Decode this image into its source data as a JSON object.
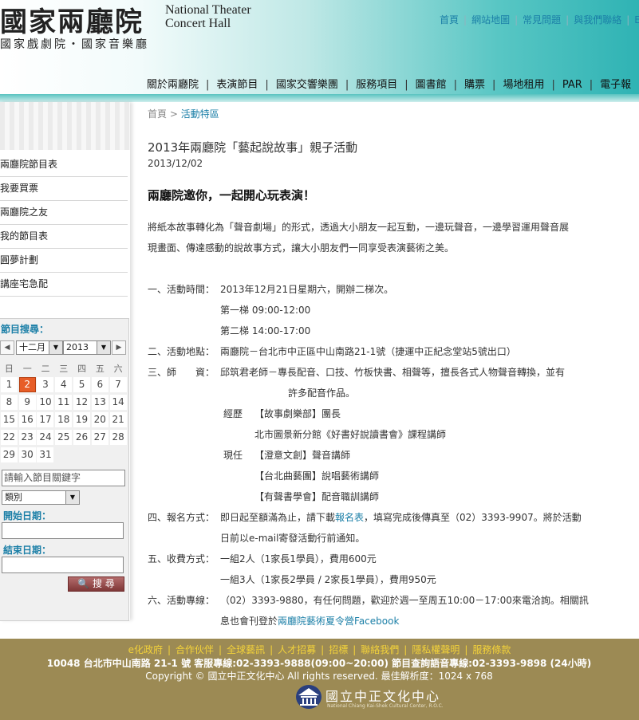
{
  "header": {
    "logo_cn": "國家兩廳院",
    "logo_en_line1": "National Theater",
    "logo_en_line2": "Concert Hall",
    "logo_sub": "國家戲劇院・國家音樂廳",
    "top_links": [
      "首頁",
      "網站地圖",
      "常見問題",
      "與我們聯絡",
      "En"
    ],
    "main_nav": [
      "關於兩廳院",
      "表演節目",
      "國家交響樂團",
      "服務項目",
      "圖書館",
      "購票",
      "場地租用",
      "PAR",
      "電子報"
    ]
  },
  "sidebar": {
    "items": [
      "兩廳院節目表",
      "我要買票",
      "兩廳院之友",
      "我的節目表",
      "圓夢計劃",
      "講座宅急配"
    ],
    "search": {
      "title": "節目搜尋：",
      "month": "十二月",
      "year": "2013",
      "weekdays": [
        "日",
        "一",
        "二",
        "三",
        "四",
        "五",
        "六"
      ],
      "weeks": [
        [
          "1",
          "2",
          "3",
          "4",
          "5",
          "6",
          "7"
        ],
        [
          "8",
          "9",
          "10",
          "11",
          "12",
          "13",
          "14"
        ],
        [
          "15",
          "16",
          "17",
          "18",
          "19",
          "20",
          "21"
        ],
        [
          "22",
          "23",
          "24",
          "25",
          "26",
          "27",
          "28"
        ],
        [
          "29",
          "30",
          "31",
          "",
          "",
          "",
          ""
        ]
      ],
      "today": "2",
      "keyword_placeholder": "請輸入節目關鍵字",
      "category": "類別",
      "start_label": "開始日期：",
      "end_label": "結束日期：",
      "search_button": "搜 尋"
    }
  },
  "breadcrumb": {
    "home": "首頁",
    "sep": ">",
    "current": "活動特區"
  },
  "article": {
    "title": "2013年兩廳院「藝起說故事」親子活動",
    "date": "2013/12/02",
    "headline": "兩廳院邀你，一起開心玩表演！",
    "intro_1": "將紙本故事轉化為「聲音劇場」的形式，透過大小朋友一起互動，一邊玩聲音，一邊學習運用聲音展",
    "intro_2": "現畫面、傳達感動的說故事方式，讓大小朋友們一同享受表演藝術之美。",
    "time_label": "一、活動時間：",
    "time_value": "2013年12月21日星期六，開辦二梯次。",
    "time_slot1": "第一梯 09:00-12:00",
    "time_slot2": "第二梯 14:00-17:00",
    "place_label": "二、活動地點：",
    "place_value": "兩廳院－台北市中正區中山南路21-1號（捷運中正紀念堂站5號出口）",
    "teacher_label": "三、師　　資：",
    "teacher_value_1": "邱筑君老師－專長配音、口技、竹板快書、相聲等，擅長各式人物聲音轉換，並有",
    "teacher_value_2": "許多配音作品。",
    "exp_label": "經歷",
    "exp_1": "【故事劇樂部】團長",
    "exp_2": "北市圖景新分館《好書好說讀書會》課程講師",
    "now_label": "現任",
    "now_1": "【澄意文創】聲音講師",
    "now_2": "【台北曲藝團】說唱藝術講師",
    "now_3": "【有聲書學會】配音職訓講師",
    "signup_label": "四、報名方式：",
    "signup_pre": "即日起至額滿為止，請下載",
    "signup_link": "報名表",
    "signup_post": "，填寫完成後傳真至（02）3393-9907。將於活動",
    "signup_line2": "日前以e-mail寄發活動行前通知。",
    "fee_label": "五、收費方式：",
    "fee_1": "一組2人（1家長1學員），費用600元",
    "fee_2": "一組3人（1家長2學員 / 2家長1學員），費用950元",
    "hotline_label": "六、活動專線：",
    "hotline_1": "（02）3393-9880，有任何問題，歡迎於週一至周五10:00－17:00來電洽詢。相關訊",
    "hotline_2_pre": "息也會刊登於",
    "hotline_2_link": "兩廳院藝術夏令營Facebook"
  },
  "footer": {
    "links": [
      "e化政府",
      "合作伙伴",
      "全球藝訊",
      "人才招募",
      "招標",
      "聯絡我們",
      "隱私權聲明",
      "服務條款"
    ],
    "address": "10048 台北市中山南路 21-1 號 客服專線:02-3393-9888(09:00~20:00)  節目查詢語音專線:02-3393-9898 (24小時)",
    "copyright": "Copyright © 國立中正文化中心 All rights reserved. 最佳解析度：1024 x 768",
    "org_cn": "國立中正文化中心",
    "org_en": "National Chiang Kai-Shek Cultural Center, R.O.C."
  },
  "colors": {
    "accent": "#1b7fa7",
    "header_teal": "#2fb3b4",
    "today": "#e75d27",
    "footer": "#9c8a54",
    "footer_links": "#f3d23a"
  }
}
